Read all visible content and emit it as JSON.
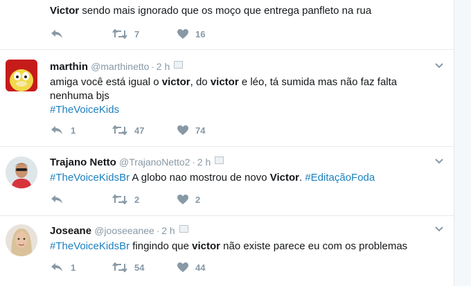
{
  "tweets": [
    {
      "name": "",
      "handle": "",
      "time": "",
      "text_parts": [
        {
          "t": "Victor",
          "b": true
        },
        {
          "t": " sendo mais ignorado que os moço que entrega panfleto na rua"
        }
      ],
      "hashtag_line": "",
      "reply_count": "",
      "retweet_count": "7",
      "like_count": "16"
    },
    {
      "name": "marthin",
      "handle": "@marthinetto",
      "time": "2 h",
      "text_line1": "amiga você está igual o ",
      "text_bold1": "victor",
      "text_mid1": ", do ",
      "text_bold2": "victor",
      "text_end1": " e léo, tá sumida mas não faz falta",
      "text_line2": "nenhuma bjs",
      "hashtag_line": "#TheVoiceKids",
      "reply_count": "1",
      "retweet_count": "47",
      "like_count": "74"
    },
    {
      "name": "Trajano Netto",
      "handle": "@TrajanoNetto2",
      "time": "2 h",
      "hashtag1": "#TheVoiceKidsBr",
      "text_mid": " A globo nao mostrou de novo ",
      "text_bold": "Victor",
      "text_dot": ". ",
      "hashtag2": "#EditaçãoFoda",
      "reply_count": "",
      "retweet_count": "2",
      "like_count": "2"
    },
    {
      "name": "Joseane",
      "handle": "@jooseeanee",
      "time": "2 h",
      "hashtag1": "#TheVoiceKidsBr",
      "text_mid": " fingindo que ",
      "text_bold": "victor",
      "text_end": " não existe parece eu com os problemas",
      "reply_count": "1",
      "retweet_count": "54",
      "like_count": "44"
    }
  ],
  "colors": {
    "hashtag": "#1b7fbf",
    "muted": "#8899a6",
    "text": "#14171a"
  },
  "icons": [
    "reply-icon",
    "retweet-icon",
    "heart-icon",
    "chevron-down-icon",
    "verified-badge-icon"
  ]
}
